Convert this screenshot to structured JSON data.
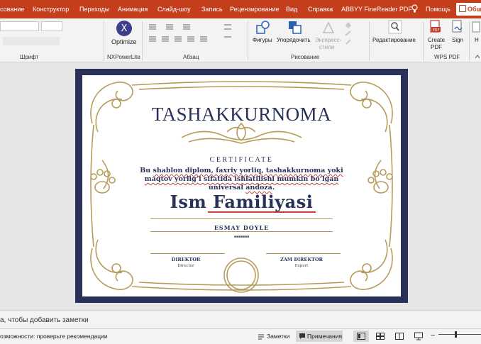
{
  "menubar": {
    "tabs": [
      "сование",
      "Конструктор",
      "Переходы",
      "Анимация",
      "Слайд-шоу",
      "Запись",
      "Рецензирование",
      "Вид",
      "Справка",
      "ABBYY FineReader PDF"
    ],
    "help": "Помощь",
    "share": "Общ"
  },
  "ribbon": {
    "font_group": "Шрифт",
    "nx_optimize": "Optimize",
    "nx_group": "NXPowerLite",
    "paragraph_group": "Абзац",
    "shapes": "Фигуры",
    "arrange": "Упорядочить",
    "express": "Экспресс-",
    "styles": "стили",
    "drawing_group": "Рисование",
    "editing": "Редактирование",
    "create_pdf_1": "Create",
    "create_pdf_2": "PDF",
    "sign": "Sign",
    "wps_group": "WPS PDF",
    "h_label": "H"
  },
  "slide": {
    "title": "TASHAKKURNOMA",
    "subtitle": "CERTIFICATE",
    "desc_line1_a": "Bu ",
    "desc_line1_b": "shablon diplom, faxriy yorliq, tashakkurnoma yoki",
    "desc_line2": "maqtov yorlig‘i sifatida ishlatilishi mumkin bo‘lgan",
    "desc_line3_a": "universal ",
    "desc_line3_b": "andoza",
    "desc_line3_c": ".",
    "name_a": "Ism ",
    "name_b": "Familiyasi",
    "person": "ESMAY DOYLE",
    "dots": "■■■■■■■",
    "sig1_title": "DIREKTOR",
    "sig1_sub": "Director",
    "sig2_title": "ZAM DIREKTOR",
    "sig2_sub": "Expert"
  },
  "notes": {
    "placeholder": "а, чтобы добавить заметки"
  },
  "status": {
    "accessibility": "озможности: проверьте рекомендации",
    "notes_btn": "Заметки",
    "comments_btn": "Примечания"
  },
  "colors": {
    "accent": "#c43e1c",
    "navy": "#2a3158",
    "gold": "#b79b5b"
  }
}
